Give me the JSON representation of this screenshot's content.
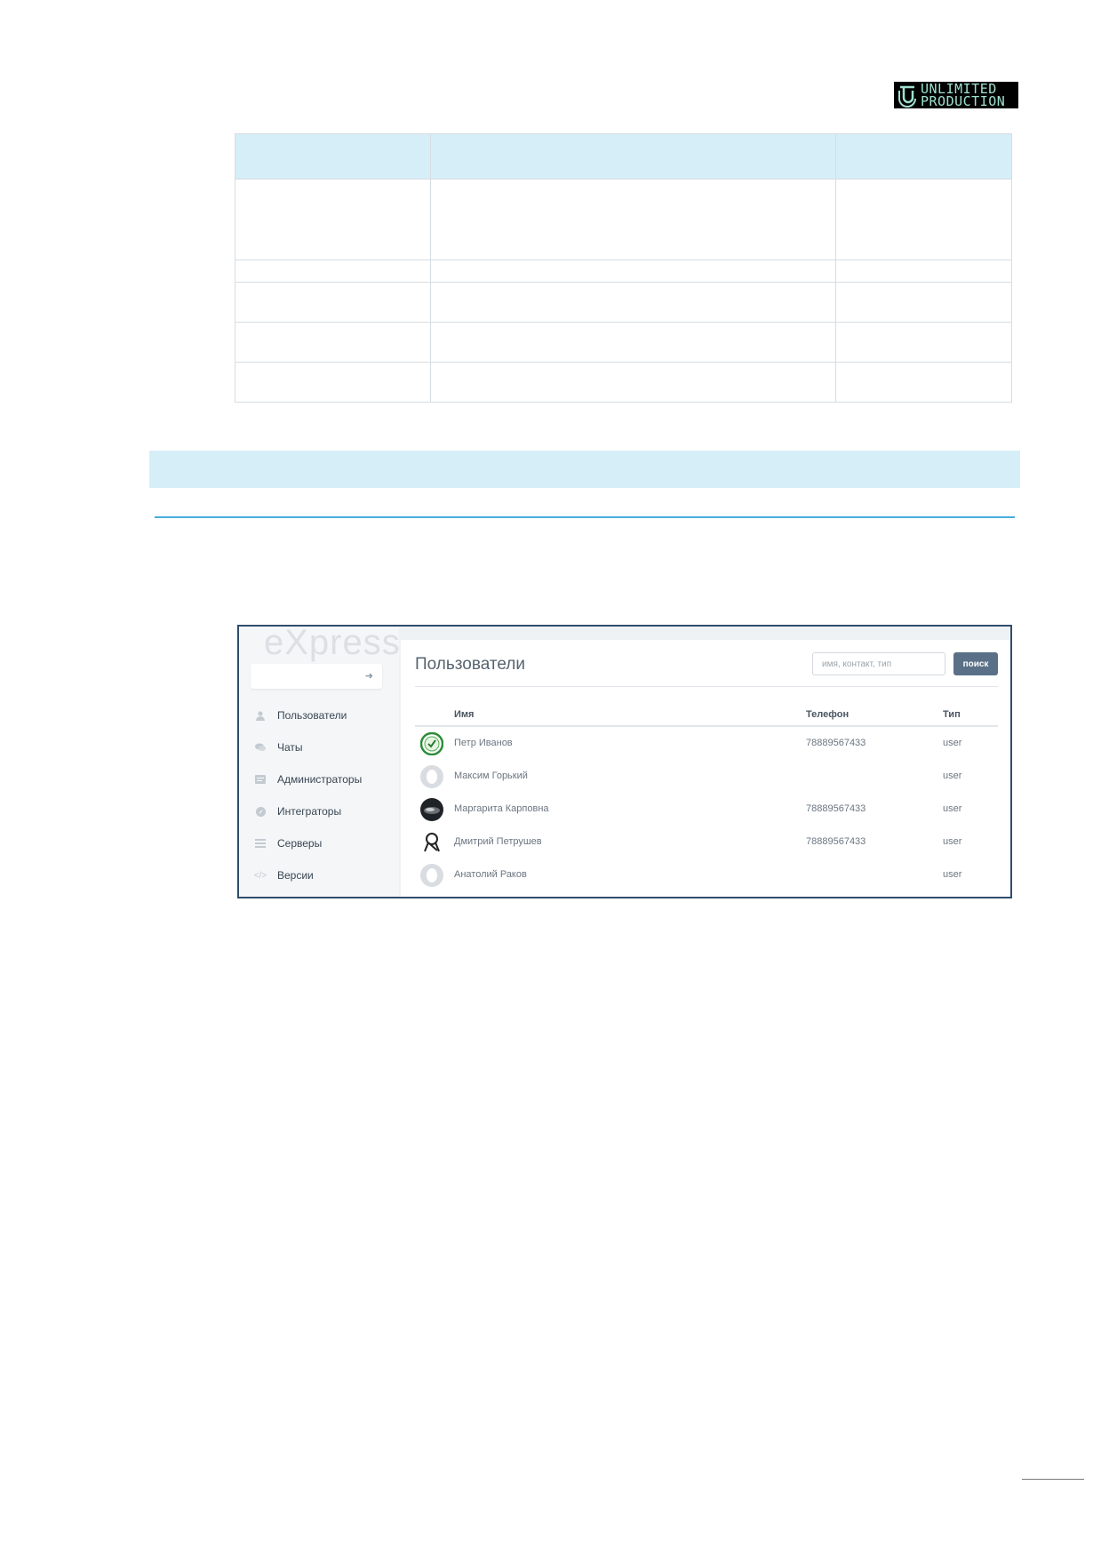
{
  "logo": {
    "line1": "UNLIMITED",
    "line2": "PRODUCTION"
  },
  "colors": {
    "header_blue": "#d6eef8",
    "rule_blue": "#4aaedc",
    "button": "#5a7087",
    "frame": "#2f4d6b"
  },
  "screenshot": {
    "brand": "eXpress",
    "page_title": "Пользователи",
    "search": {
      "placeholder": "имя, контакт, тип",
      "value": "",
      "button_label": "поиск"
    },
    "nav": [
      {
        "label": "Пользователи",
        "icon": "user-icon"
      },
      {
        "label": "Чаты",
        "icon": "chat-icon"
      },
      {
        "label": "Администраторы",
        "icon": "admin-card-icon"
      },
      {
        "label": "Интеграторы",
        "icon": "compass-icon"
      },
      {
        "label": "Серверы",
        "icon": "server-list-icon"
      },
      {
        "label": "Версии",
        "icon": "code-icon"
      }
    ],
    "table": {
      "headers": {
        "name": "Имя",
        "phone": "Телефон",
        "type": "Тип"
      },
      "rows": [
        {
          "name": "Петр Иванов",
          "phone": "78889567433",
          "type": "user",
          "avatar": "green-check-avatar"
        },
        {
          "name": "Максим Горький",
          "phone": "",
          "type": "user",
          "avatar": "default-avatar"
        },
        {
          "name": "Маргарита Карповна",
          "phone": "78889567433",
          "type": "user",
          "avatar": "photo-avatar"
        },
        {
          "name": "Дмитрий Петрушев",
          "phone": "78889567433",
          "type": "user",
          "avatar": "ribbon-avatar"
        },
        {
          "name": "Анатолий Раков",
          "phone": "",
          "type": "user",
          "avatar": "default-avatar"
        }
      ]
    }
  }
}
